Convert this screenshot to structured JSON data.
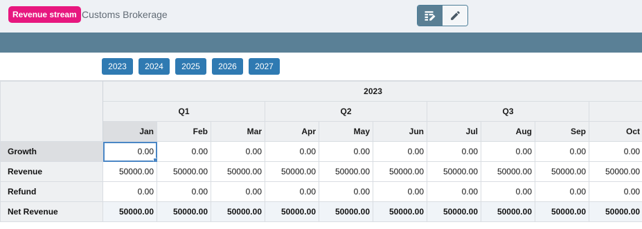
{
  "header": {
    "badge": "Revenue stream",
    "title": "Customs Brokerage",
    "view_toggle": [
      {
        "icon": "table-edit-icon",
        "active": true
      },
      {
        "icon": "pencil-icon",
        "active": false
      }
    ]
  },
  "years": [
    "2023",
    "2024",
    "2025",
    "2026",
    "2027"
  ],
  "grid": {
    "year": "2023",
    "quarters": [
      "Q1",
      "Q2",
      "Q3"
    ],
    "months": [
      "Jan",
      "Feb",
      "Mar",
      "Apr",
      "May",
      "Jun",
      "Jul",
      "Aug",
      "Sep",
      "Oct"
    ],
    "rows": [
      {
        "label": "Growth",
        "values": [
          "0.00",
          "0.00",
          "0.00",
          "0.00",
          "0.00",
          "0.00",
          "0.00",
          "0.00",
          "0.00",
          "0.00"
        ]
      },
      {
        "label": "Revenue",
        "values": [
          "50000.00",
          "50000.00",
          "50000.00",
          "50000.00",
          "50000.00",
          "50000.00",
          "50000.00",
          "50000.00",
          "50000.00",
          "50000.00"
        ]
      },
      {
        "label": "Refund",
        "values": [
          "0.00",
          "0.00",
          "0.00",
          "0.00",
          "0.00",
          "0.00",
          "0.00",
          "0.00",
          "0.00",
          "0.00"
        ]
      },
      {
        "label": "Net Revenue",
        "values": [
          "50000.00",
          "50000.00",
          "50000.00",
          "50000.00",
          "50000.00",
          "50000.00",
          "50000.00",
          "50000.00",
          "50000.00",
          "50000.00"
        ]
      }
    ]
  },
  "colors": {
    "badge": "#e7177f",
    "header_bar": "#5a8096",
    "year_button": "#2f7ab2",
    "selection": "#4a86c5"
  }
}
